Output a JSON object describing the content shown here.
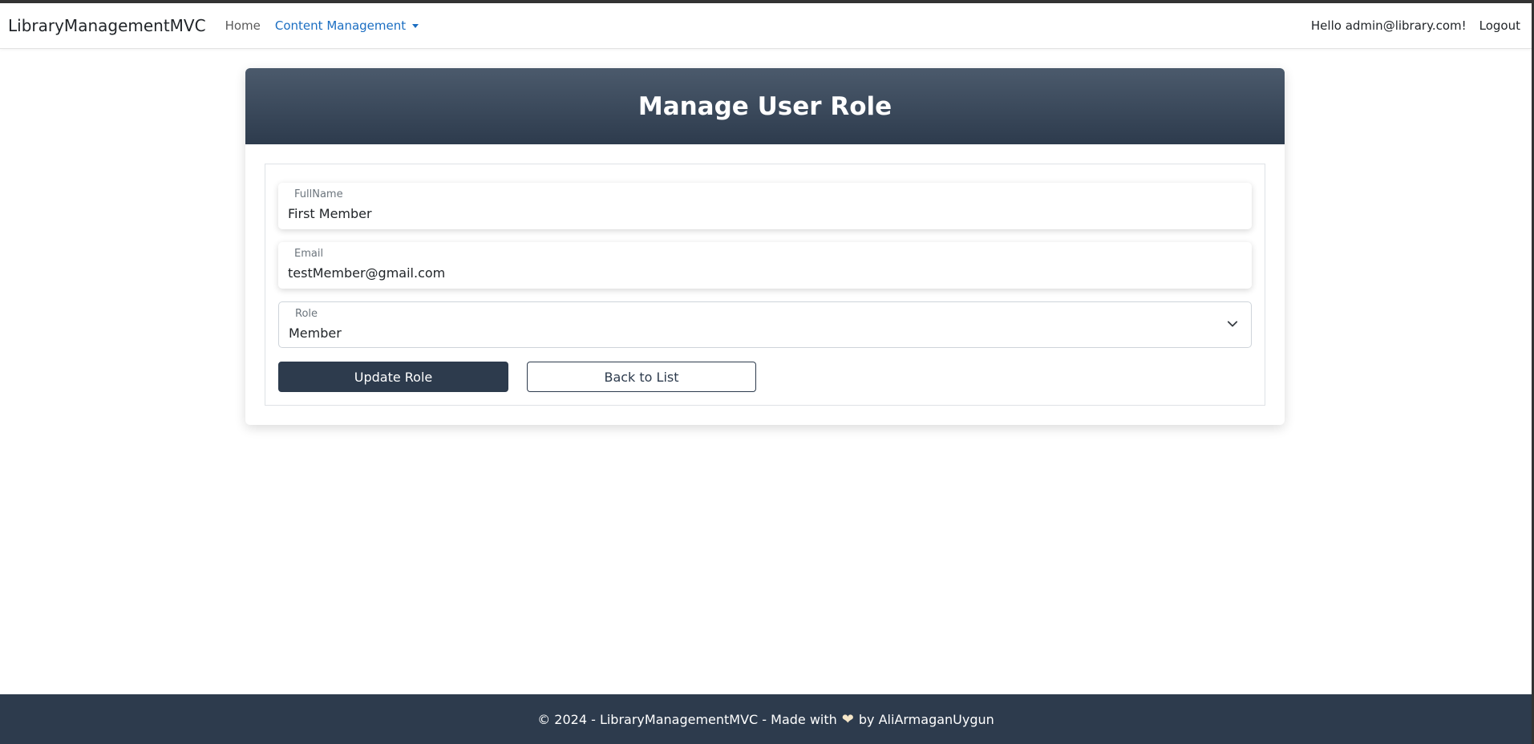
{
  "navbar": {
    "brand": "LibraryManagementMVC",
    "home": "Home",
    "content_management": "Content Management",
    "greeting": "Hello admin@library.com!",
    "logout": "Logout"
  },
  "card": {
    "title": "Manage User Role"
  },
  "form": {
    "fullname_label": "FullName",
    "fullname_value": "First Member",
    "email_label": "Email",
    "email_value": "testMember@gmail.com",
    "role_label": "Role",
    "role_value": "Member",
    "update_button": "Update Role",
    "back_button": "Back to List"
  },
  "footer": {
    "text_before": "© 2024 - LibraryManagementMVC - Made with",
    "heart_icon": "heart-icon",
    "text_after": "by AliArmaganUygun"
  },
  "colors": {
    "primary_dark": "#2d3b4d",
    "link_blue": "#1b6ec2"
  }
}
